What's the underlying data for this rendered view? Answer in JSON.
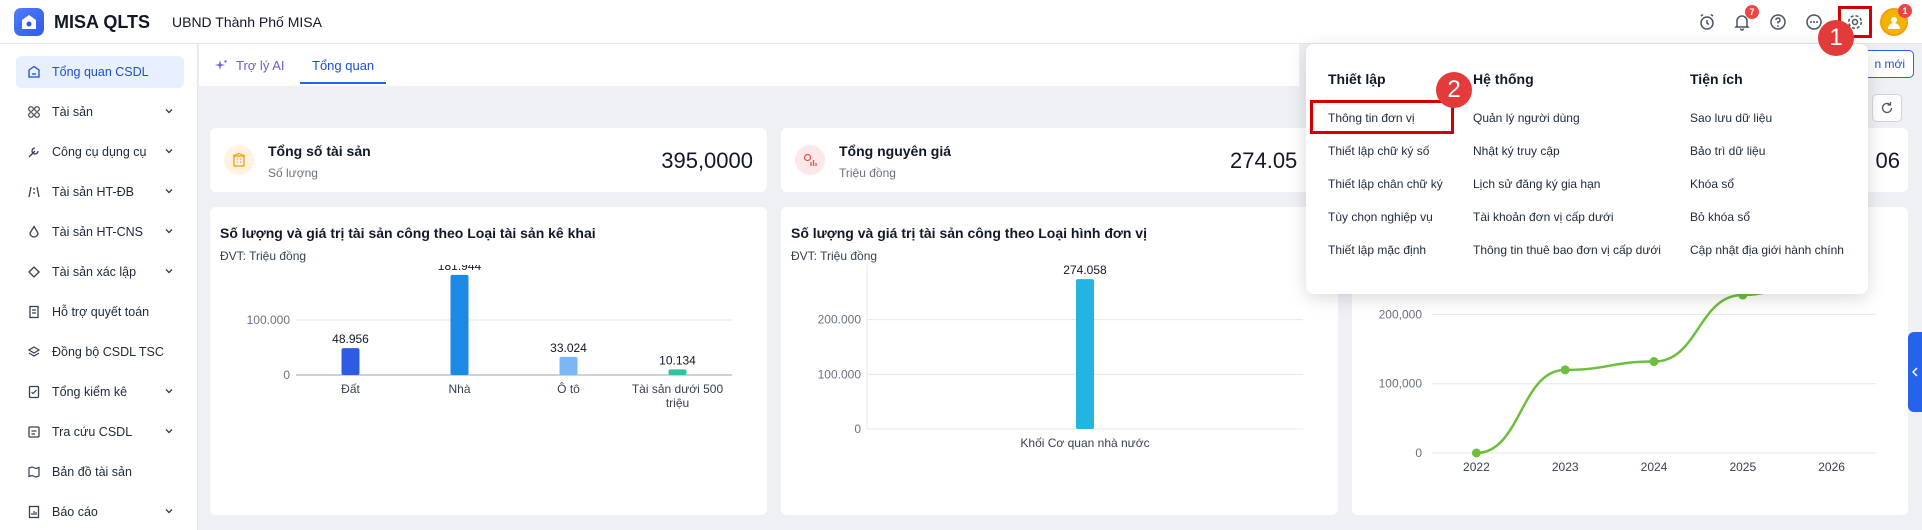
{
  "app": {
    "name": "MISA QLTS",
    "org": "UBND Thành Phố MISA"
  },
  "header": {
    "notifications_count": "7",
    "avatar_badge": "1"
  },
  "steps": [
    "1",
    "2"
  ],
  "sidebar": {
    "items": [
      {
        "label": "Tổng quan CSDL",
        "icon": "database-icon",
        "active": true,
        "expandable": false
      },
      {
        "label": "Tài sản",
        "icon": "assets-icon",
        "expandable": true
      },
      {
        "label": "Công cụ dụng cụ",
        "icon": "tools-icon",
        "expandable": true
      },
      {
        "label": "Tài sản HT-ĐB",
        "icon": "road-icon",
        "expandable": true
      },
      {
        "label": "Tài sản HT-CNS",
        "icon": "water-drop-icon",
        "expandable": true
      },
      {
        "label": "Tài sản xác lập",
        "icon": "asset-establish-icon",
        "expandable": true
      },
      {
        "label": "Hỗ trợ quyết toán",
        "icon": "document-icon",
        "expandable": false
      },
      {
        "label": "Đồng bộ CSDL TSC",
        "icon": "layers-icon",
        "expandable": false
      },
      {
        "label": "Tổng kiểm kê",
        "icon": "checklist-icon",
        "expandable": true
      },
      {
        "label": "Tra cứu CSDL",
        "icon": "search-db-icon",
        "expandable": true
      },
      {
        "label": "Bản đồ tài sản",
        "icon": "map-icon",
        "expandable": false
      },
      {
        "label": "Báo cáo",
        "icon": "report-icon",
        "expandable": true
      }
    ]
  },
  "tabs": {
    "ai": "Trợ lý AI",
    "overview": "Tổng quan"
  },
  "toolbar": {
    "new_button": "n mới"
  },
  "kpis": [
    {
      "title": "Tổng số tài sản",
      "sub": "Số lượng",
      "value": "395,0000"
    },
    {
      "title": "Tổng nguyên giá",
      "sub": "Triệu đồng",
      "value": "274.05"
    },
    {
      "value": "06"
    }
  ],
  "charts": [
    {
      "title": "Số lượng và giá trị tài sản công theo Loại tài sản kê khai",
      "unit": "ĐVT: Triệu đồng"
    },
    {
      "title": "Số lượng và giá trị tài sản công theo Loại hình đơn vị",
      "unit": "ĐVT: Triệu đồng"
    }
  ],
  "chart_data": [
    {
      "type": "bar",
      "categories": [
        "Đất",
        "Nhà",
        "Ô tô",
        "Tài sản dưới 500 triệu"
      ],
      "values": [
        48.956,
        181.944,
        33.024,
        10.134
      ],
      "value_labels": [
        "48.956",
        "181.944",
        "33.024",
        "10.134"
      ],
      "yticks": [
        "0",
        "100.000"
      ],
      "ylim": [
        0,
        200
      ],
      "colors": [
        "#2d5be3",
        "#1e88e5",
        "#7cb7f5",
        "#2ec4a0"
      ]
    },
    {
      "type": "bar",
      "categories": [
        "Khối Cơ quan nhà nước"
      ],
      "values": [
        274.058
      ],
      "value_labels": [
        "274.058"
      ],
      "yticks": [
        "0",
        "100.000",
        "200.000"
      ],
      "ylim": [
        0,
        300
      ],
      "colors": [
        "#22b5e0"
      ]
    },
    {
      "type": "line",
      "x": [
        "2022",
        "2023",
        "2024",
        "2025",
        "2026"
      ],
      "values": [
        0,
        120000,
        132000,
        228000,
        262000
      ],
      "yticks": [
        "0",
        "100,000",
        "200,000"
      ],
      "ylim": [
        0,
        280000
      ],
      "color": "#6cbf3a"
    }
  ],
  "dropdown": {
    "columns": [
      {
        "heading": "Thiết lập",
        "items": [
          "Thông tin đơn vị",
          "Thiết lập chữ ký số",
          "Thiết lập chân chữ ký",
          "Tùy chọn nghiệp vụ",
          "Thiết lập mặc định"
        ]
      },
      {
        "heading": "Hệ thống",
        "items": [
          "Quản lý người dùng",
          "Nhật ký truy cập",
          "Lịch sử đăng ký gia hạn",
          "Tài khoản đơn vị cấp dưới",
          "Thông tin thuê bao đơn vị cấp dưới"
        ]
      },
      {
        "heading": "Tiện ích",
        "items": [
          "Sao lưu dữ liệu",
          "Bảo trì dữ liệu",
          "Khóa sổ",
          "Bỏ khóa sổ",
          "Cập nhật địa giới hành chính"
        ]
      }
    ]
  }
}
